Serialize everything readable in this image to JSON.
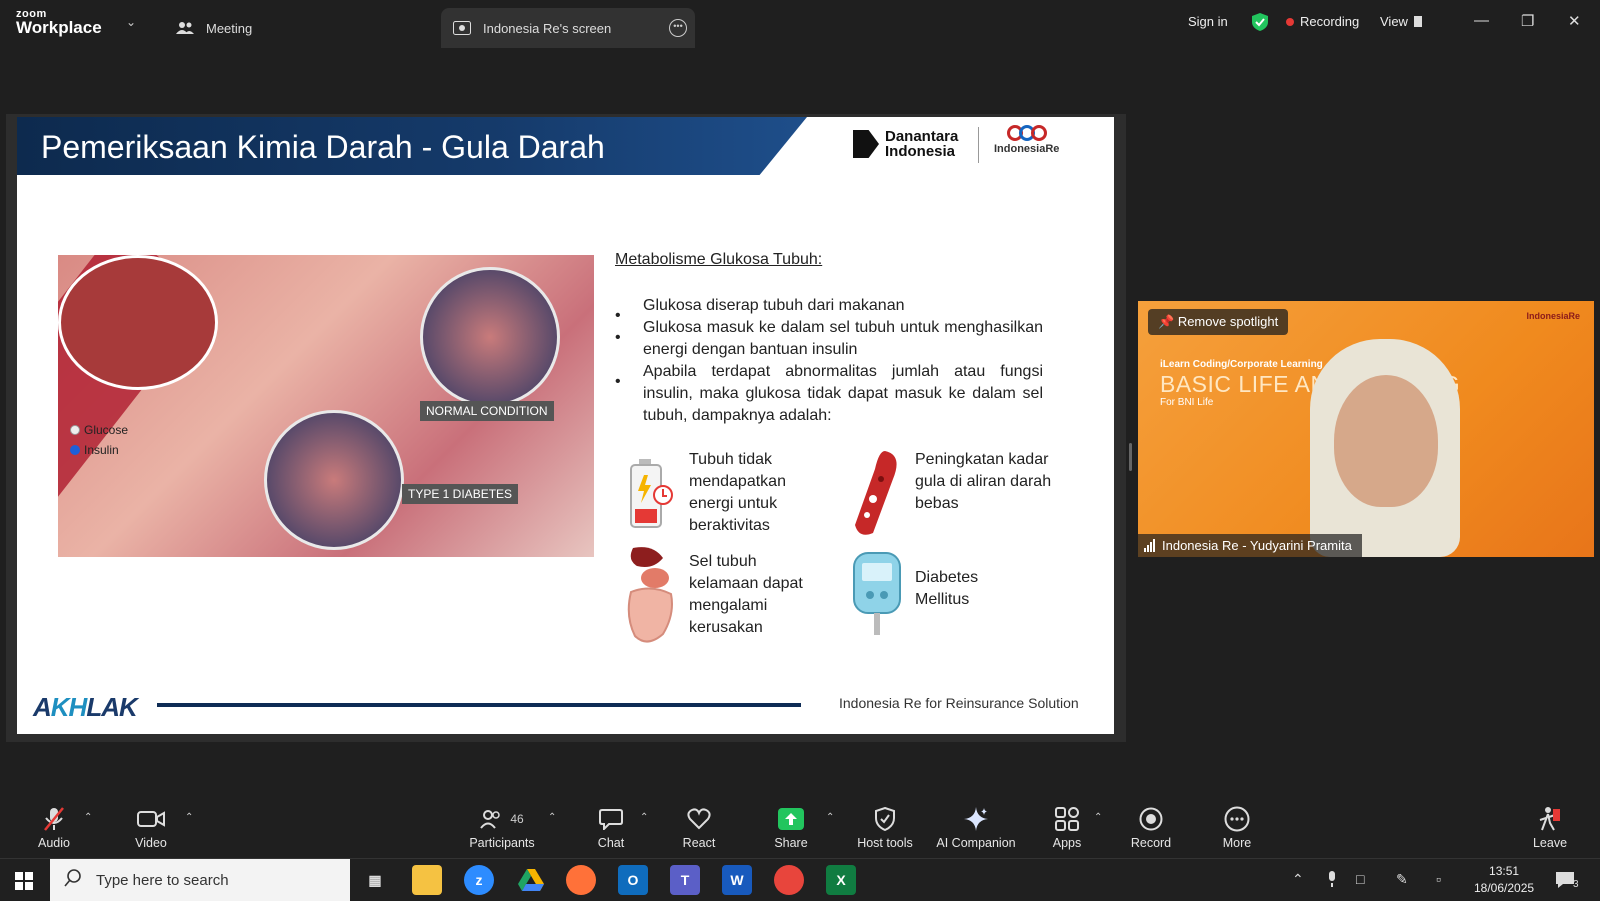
{
  "app": {
    "logo_small": "zoom",
    "logo_big": "Workplace"
  },
  "tabs": [
    {
      "label": "Meeting"
    },
    {
      "label": "Indonesia Re's screen"
    }
  ],
  "header_right": {
    "sign_in": "Sign in",
    "recording": "Recording",
    "view": "View"
  },
  "colors": {
    "recording_dot": "#e53935",
    "shield": "#22c55e",
    "share_green": "#22c55e",
    "slide_navy": "#0d2a4e"
  },
  "slide": {
    "title": "Pemeriksaan Kimia Darah - Gula Darah",
    "brand_dana_line1": "Danantara",
    "brand_dana_line2": "Indonesia",
    "brand_ire": "IndonesiaRe",
    "illustration": {
      "legend_glucose": "Glucose",
      "legend_insulin": "Insulin",
      "caption_normal": "NORMAL CONDITION",
      "caption_type1": "TYPE 1 DIABETES"
    },
    "section_title": "Metabolisme Glukosa Tubuh:",
    "bullets": [
      "Glukosa diserap tubuh dari makanan",
      "Glukosa masuk ke dalam sel tubuh untuk menghasilkan energi dengan bantuan insulin",
      "Apabila terdapat abnormalitas jumlah atau fungsi insulin, maka glukosa tidak dapat masuk ke dalam sel tubuh, dampaknya adalah:"
    ],
    "effects": [
      {
        "icon": "battery-low-icon",
        "text": "Tubuh tidak mendapatkan energi untuk beraktivitas"
      },
      {
        "icon": "blood-vessel-icon",
        "text": "Peningkatan kadar gula di aliran darah bebas"
      },
      {
        "icon": "organs-icon",
        "text": "Sel tubuh kelamaan dapat mengalami kerusakan"
      },
      {
        "icon": "glucometer-icon",
        "text": "Diabetes Mellitus"
      }
    ],
    "footer_logo_a": "A",
    "footer_logo_h": "KH",
    "footer_logo_rest": "LAK",
    "footer_text": "Indonesia Re for Reinsurance Solution"
  },
  "video": {
    "remove_spotlight": "Remove spotlight",
    "bg_subtitle": "iLearn Coding/Corporate Learning",
    "bg_title": "BASIC LIFE AND ... AINING",
    "bg_for": "For BNI Life",
    "bg_brand": "IndonesiaRe",
    "participant_name": "Indonesia Re - Yudyarini Pramita"
  },
  "toolbar": {
    "audio": "Audio",
    "video": "Video",
    "participants": "Participants",
    "participants_count": "46",
    "chat": "Chat",
    "react": "React",
    "share": "Share",
    "host_tools": "Host tools",
    "ai_companion": "AI Companion",
    "apps": "Apps",
    "record": "Record",
    "more": "More",
    "leave": "Leave"
  },
  "taskbar": {
    "search_placeholder": "Type here to search",
    "time": "13:51",
    "date": "18/06/2025",
    "notification_count": "3"
  }
}
